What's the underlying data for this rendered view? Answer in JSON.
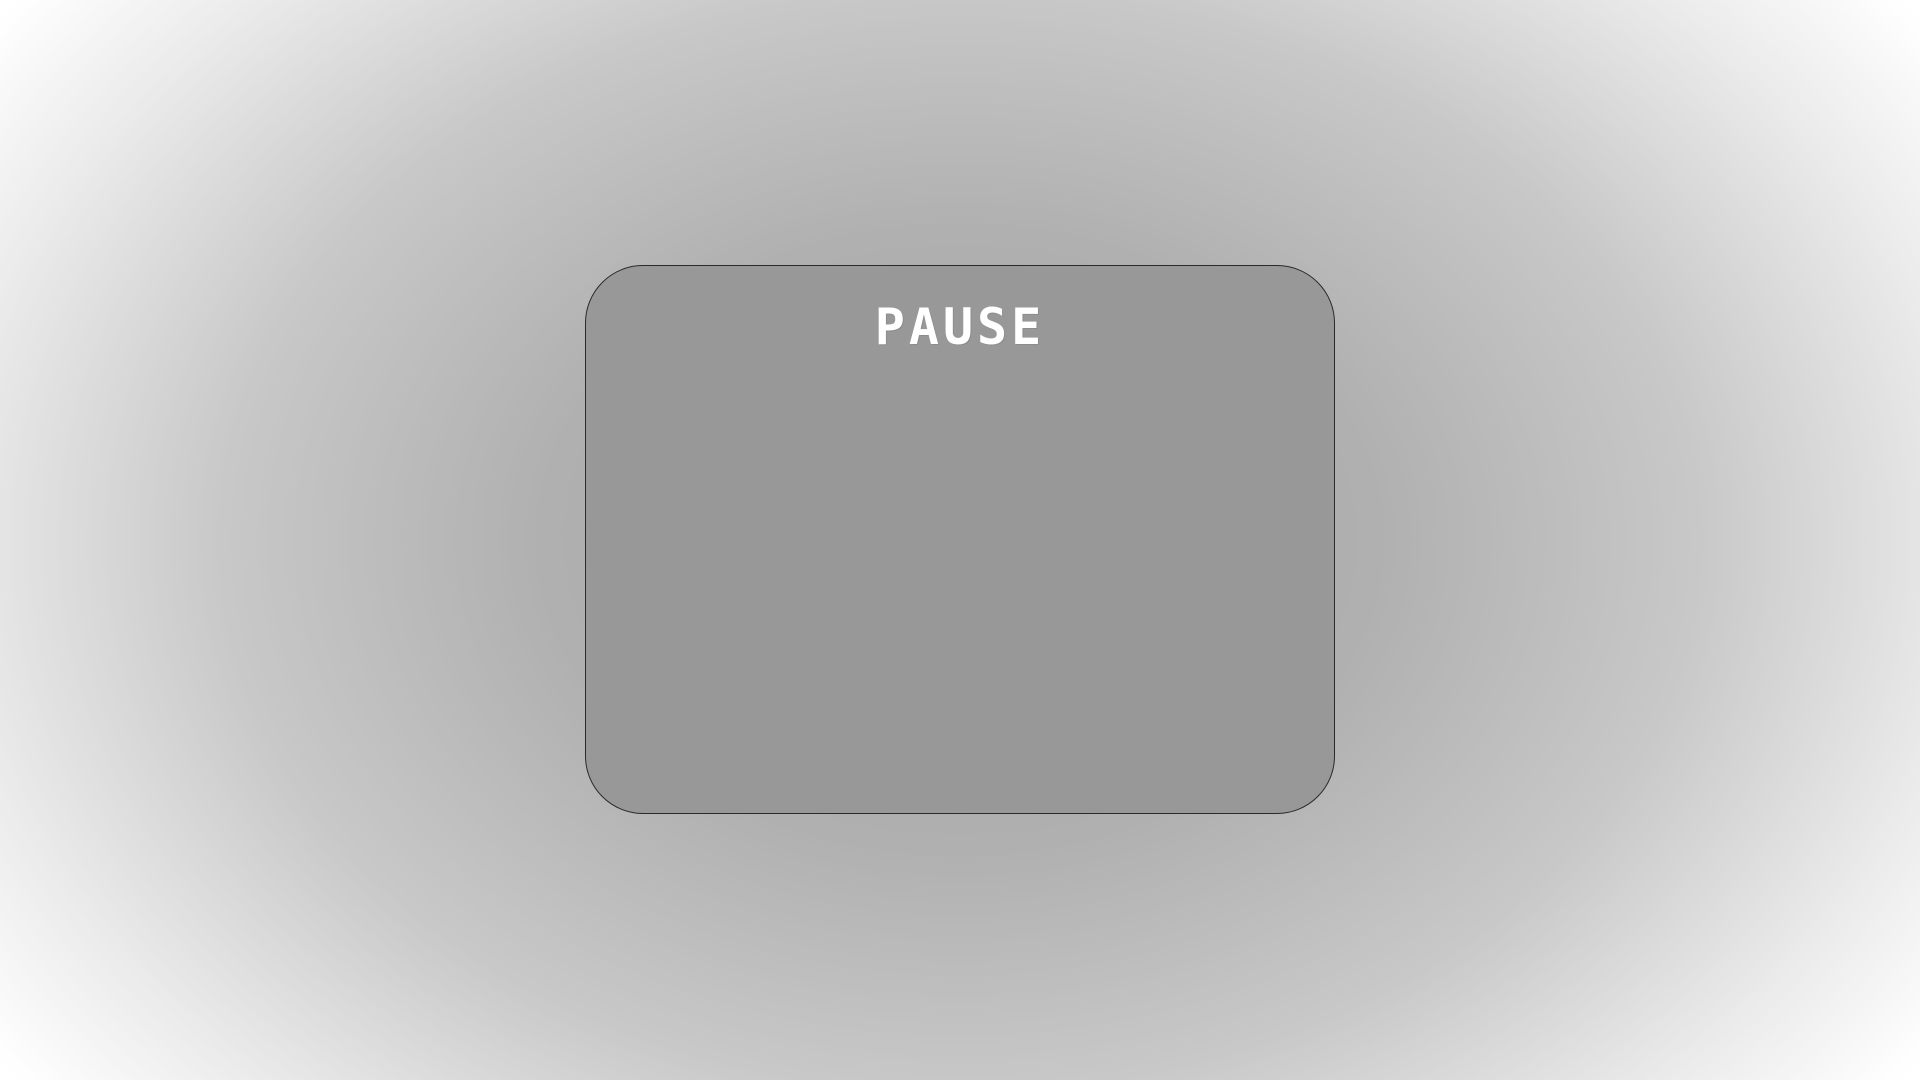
{
  "pause_menu": {
    "title": "PAUSE"
  },
  "colors": {
    "panel_background": "#989898",
    "panel_border": "#2a2a2a",
    "title_text": "#ffffff",
    "vignette_center": "#a3a3a3",
    "vignette_edge": "#ffffff"
  }
}
